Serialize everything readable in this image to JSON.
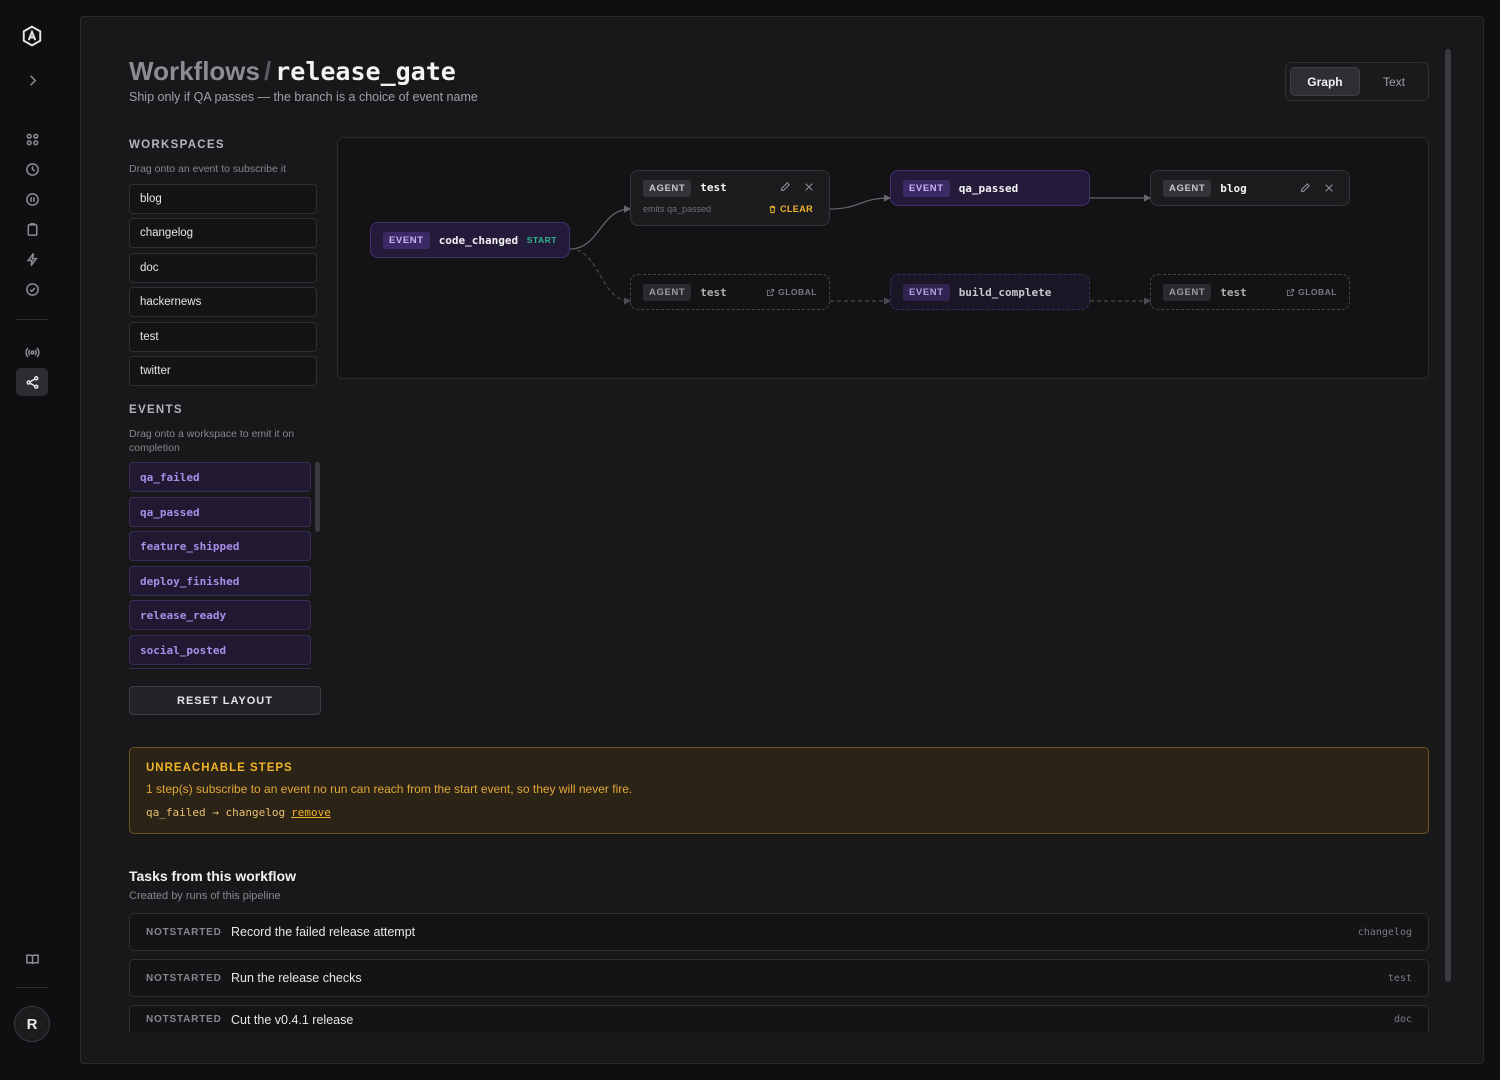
{
  "header": {
    "crumb": "Workflows",
    "separator": "/",
    "workflow_name": "release_gate",
    "subtitle": "Ship only if QA passes — the branch is a choice of event name"
  },
  "view_toggle": {
    "graph": "Graph",
    "text": "Text",
    "selected": "Graph"
  },
  "workspaces": {
    "heading": "WORKSPACES",
    "hint": "Drag onto an event to subscribe it",
    "items": [
      "blog",
      "changelog",
      "doc",
      "hackernews",
      "test",
      "twitter"
    ]
  },
  "events": {
    "heading": "EVENTS",
    "hint": "Drag onto a workspace to emit it on completion",
    "items": [
      "qa_failed",
      "qa_passed",
      "feature_shipped",
      "deploy_finished",
      "release_ready",
      "social_posted"
    ]
  },
  "reset_label": "RESET LAYOUT",
  "graph": {
    "event_tag": "EVENT",
    "agent_tag": "AGENT",
    "start_node": {
      "name": "code_changed",
      "badge": "START"
    },
    "node_test": {
      "name": "test",
      "emits": "emits qa_passed",
      "clear": "CLEAR"
    },
    "node_qa_passed": {
      "name": "qa_passed"
    },
    "node_blog": {
      "name": "blog"
    },
    "ghost_test": {
      "name": "test",
      "badge": "GLOBAL"
    },
    "ghost_build": {
      "name": "build_complete"
    },
    "ghost_test2": {
      "name": "test",
      "badge": "GLOBAL"
    }
  },
  "alert": {
    "heading": "UNREACHABLE STEPS",
    "text": "1 step(s) subscribe to an event no run can reach from the start event, so they will never fire.",
    "rule": "qa_failed → changelog",
    "action": "remove",
    "color": "#f0b429"
  },
  "tasks": {
    "heading": "Tasks from this workflow",
    "subtitle": "Created by runs of this pipeline",
    "rows": [
      {
        "status": "NOTSTARTED",
        "title": "Record the failed release attempt",
        "workspace": "changelog"
      },
      {
        "status": "NOTSTARTED",
        "title": "Run the release checks",
        "workspace": "test"
      },
      {
        "status": "NOTSTARTED",
        "title": "Cut the v0.4.1 release",
        "workspace": "doc"
      }
    ]
  },
  "user": {
    "initial": "R"
  },
  "colors": {
    "accent_event": "#a98ee8",
    "start": "#2fb58a",
    "warning": "#f0b429"
  }
}
